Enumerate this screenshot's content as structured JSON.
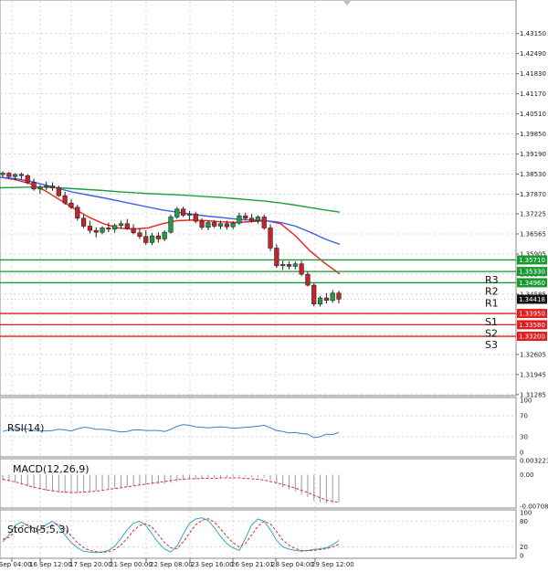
{
  "chart_data": [
    {
      "type": "candlestick",
      "ylim": [
        1.3128,
        1.4422
      ],
      "yticks": [
        "1.43150",
        "1.42490",
        "1.41830",
        "1.41170",
        "1.40510",
        "1.39850",
        "1.39190",
        "1.38530",
        "1.37870",
        "1.37225",
        "1.36565",
        "1.35905",
        "1.35245",
        "1.34585",
        "1.33925",
        "1.33265",
        "1.32605",
        "1.31945",
        "1.31285"
      ],
      "xticks": [
        "Sep 04:00",
        "16 Sep 12:00",
        "17 Sep 20:00",
        "21 Sep 00:00",
        "22 Sep 08:00",
        "23 Sep 16:00",
        "26 Sep 21:01",
        "28 Sep 04:00",
        "29 Sep 12:00"
      ],
      "candles": [
        [
          1.3851,
          1.3862,
          1.3843,
          1.3856
        ],
        [
          1.3856,
          1.386,
          1.3838,
          1.3845
        ],
        [
          1.3845,
          1.3856,
          1.3832,
          1.3852
        ],
        [
          1.3852,
          1.3858,
          1.3835,
          1.3848
        ],
        [
          1.3848,
          1.3852,
          1.382,
          1.3826
        ],
        [
          1.3826,
          1.3838,
          1.3798,
          1.3804
        ],
        [
          1.3804,
          1.3818,
          1.3788,
          1.381
        ],
        [
          1.381,
          1.3828,
          1.38,
          1.3814
        ],
        [
          1.3814,
          1.3826,
          1.3798,
          1.3808
        ],
        [
          1.3808,
          1.3815,
          1.3778,
          1.3782
        ],
        [
          1.3782,
          1.3795,
          1.3752,
          1.3758
        ],
        [
          1.3758,
          1.377,
          1.3738,
          1.3744
        ],
        [
          1.3744,
          1.3752,
          1.37,
          1.3708
        ],
        [
          1.3708,
          1.372,
          1.3675,
          1.3682
        ],
        [
          1.3682,
          1.37,
          1.3658,
          1.3668
        ],
        [
          1.3668,
          1.3678,
          1.3645,
          1.3662
        ],
        [
          1.3662,
          1.3682,
          1.3655,
          1.3676
        ],
        [
          1.3676,
          1.3694,
          1.3662,
          1.3672
        ],
        [
          1.3672,
          1.369,
          1.366,
          1.3684
        ],
        [
          1.3684,
          1.37,
          1.3676,
          1.369
        ],
        [
          1.369,
          1.3706,
          1.367,
          1.3675
        ],
        [
          1.3675,
          1.3688,
          1.3655,
          1.366
        ],
        [
          1.366,
          1.3676,
          1.364,
          1.3648
        ],
        [
          1.3648,
          1.3668,
          1.362,
          1.3628
        ],
        [
          1.3628,
          1.366,
          1.362,
          1.365
        ],
        [
          1.365,
          1.3662,
          1.3628,
          1.364
        ],
        [
          1.364,
          1.3668,
          1.3632,
          1.3662
        ],
        [
          1.3662,
          1.372,
          1.3658,
          1.3712
        ],
        [
          1.3712,
          1.3745,
          1.3706,
          1.3738
        ],
        [
          1.3738,
          1.3746,
          1.3712,
          1.3718
        ],
        [
          1.3718,
          1.3732,
          1.3702,
          1.3722
        ],
        [
          1.3722,
          1.373,
          1.3692,
          1.3698
        ],
        [
          1.3698,
          1.3708,
          1.367,
          1.3678
        ],
        [
          1.3678,
          1.37,
          1.3668,
          1.3694
        ],
        [
          1.3694,
          1.3702,
          1.3676,
          1.3682
        ],
        [
          1.3682,
          1.37,
          1.3672,
          1.369
        ],
        [
          1.369,
          1.37,
          1.367,
          1.368
        ],
        [
          1.368,
          1.3698,
          1.3672,
          1.3692
        ],
        [
          1.3692,
          1.3726,
          1.3686,
          1.3716
        ],
        [
          1.3716,
          1.3726,
          1.37,
          1.3708
        ],
        [
          1.3708,
          1.3722,
          1.3694,
          1.37
        ],
        [
          1.37,
          1.3718,
          1.369,
          1.3712
        ],
        [
          1.3712,
          1.372,
          1.367,
          1.3676
        ],
        [
          1.3676,
          1.3688,
          1.36,
          1.361
        ],
        [
          1.361,
          1.3622,
          1.3545,
          1.3552
        ],
        [
          1.3552,
          1.3568,
          1.3538,
          1.3556
        ],
        [
          1.3556,
          1.3566,
          1.354,
          1.355
        ],
        [
          1.355,
          1.3566,
          1.354,
          1.3558
        ],
        [
          1.3558,
          1.3568,
          1.3518,
          1.3524
        ],
        [
          1.3524,
          1.3532,
          1.3484,
          1.3488
        ],
        [
          1.3488,
          1.3494,
          1.3418,
          1.3426
        ],
        [
          1.3426,
          1.3452,
          1.3418,
          1.3446
        ],
        [
          1.3446,
          1.3462,
          1.3428,
          1.3438
        ],
        [
          1.3438,
          1.3472,
          1.343,
          1.3462
        ],
        [
          1.3462,
          1.347,
          1.3428,
          1.3442
        ]
      ],
      "moving_averages": [
        {
          "color": "#e8231a",
          "values": [
            1.3843,
            1.3835,
            1.3822,
            1.38,
            1.377,
            1.374,
            1.3712,
            1.369,
            1.3676,
            1.3672,
            1.3676,
            1.369,
            1.37,
            1.3702,
            1.37,
            1.3696,
            1.3694,
            1.3697,
            1.37,
            1.369,
            1.365,
            1.36,
            1.356,
            1.3525
          ]
        },
        {
          "color": "#3d5ee8",
          "values": [
            1.3843,
            1.3838,
            1.383,
            1.3818,
            1.3805,
            1.3793,
            1.3784,
            1.3775,
            1.3765,
            1.3755,
            1.3745,
            1.3735,
            1.3728,
            1.3721,
            1.3715,
            1.371,
            1.3705,
            1.3702,
            1.37,
            1.3694,
            1.3682,
            1.3662,
            1.364,
            1.3622
          ]
        },
        {
          "color": "#1e9e3f",
          "values": [
            1.3808,
            1.3809,
            1.381,
            1.381,
            1.3808,
            1.3805,
            1.3802,
            1.3799,
            1.3795,
            1.3792,
            1.3789,
            1.3787,
            1.3785,
            1.3782,
            1.3779,
            1.3776,
            1.3772,
            1.3768,
            1.3764,
            1.3758,
            1.3751,
            1.3743,
            1.3735,
            1.3728
          ]
        }
      ],
      "levels": [
        {
          "value": 1.3571,
          "label": "1.35710",
          "name": "",
          "color": "#1a9a2e"
        },
        {
          "value": 1.3533,
          "label": "1.35330",
          "name": "R3",
          "color": "#1a9a2e"
        },
        {
          "value": 1.3496,
          "label": "1.34960",
          "name": "R2",
          "color": "#1a9a2e"
        },
        {
          "value": 1.3395,
          "label": "1.33950",
          "name": "S1",
          "color": "#e21d1d"
        },
        {
          "value": 1.3358,
          "label": "1.33580",
          "name": "S2",
          "color": "#e21d1d"
        },
        {
          "value": 1.332,
          "label": "1.33200",
          "name": "S3",
          "color": "#e21d1d"
        }
      ],
      "r1_label": "R1",
      "current_price": {
        "value": 1.34418,
        "label": "1.34418"
      }
    },
    {
      "type": "line",
      "label": "RSI(14)",
      "ylim": [
        0,
        100
      ],
      "yticks": [
        "100",
        "70",
        "30",
        "0"
      ],
      "color": "#3a7ec8",
      "values": [
        40,
        43,
        44,
        44,
        45,
        42,
        41,
        41,
        42,
        44,
        43,
        41,
        45,
        48,
        47,
        44,
        44,
        43,
        41,
        39,
        40,
        43,
        43,
        42,
        42,
        42,
        40,
        44,
        50,
        53,
        52,
        49,
        48,
        47,
        48,
        49,
        48,
        46,
        47,
        48,
        49,
        50,
        52,
        47,
        42,
        40,
        37,
        38,
        36,
        35,
        28,
        30,
        35,
        34,
        38
      ]
    },
    {
      "type": "bar",
      "label": "MACD(12,26,9)",
      "ylim": [
        -0.007088,
        0.003223
      ],
      "yticks": [
        "0.003223",
        "0.00",
        "-0.007088"
      ],
      "bars": [
        -0.0012,
        -0.0015,
        -0.0018,
        -0.0022,
        -0.0026,
        -0.003,
        -0.0033,
        -0.0036,
        -0.0038,
        -0.004,
        -0.0041,
        -0.0042,
        -0.0041,
        -0.004,
        -0.0038,
        -0.0036,
        -0.0034,
        -0.0032,
        -0.003,
        -0.0028,
        -0.0026,
        -0.0025,
        -0.0024,
        -0.0023,
        -0.0022,
        -0.0021,
        -0.002,
        -0.0018,
        -0.0015,
        -0.0012,
        -0.001,
        -0.0009,
        -0.0008,
        -0.0008,
        -0.0007,
        -0.0006,
        -0.0006,
        -0.0005,
        -0.0004,
        -0.0004,
        -0.0005,
        -0.0005,
        -0.0006,
        -0.0012,
        -0.002,
        -0.0028,
        -0.0033,
        -0.0038,
        -0.0044,
        -0.005,
        -0.0058,
        -0.0062,
        -0.0064,
        -0.0063,
        -0.0062
      ],
      "signal": [
        -0.001,
        -0.0013,
        -0.0016,
        -0.002,
        -0.0024,
        -0.0028,
        -0.0031,
        -0.0034,
        -0.0036,
        -0.0038,
        -0.0039,
        -0.004,
        -0.004,
        -0.0039,
        -0.0038,
        -0.0037,
        -0.0035,
        -0.0033,
        -0.0031,
        -0.0029,
        -0.0027,
        -0.0025,
        -0.0023,
        -0.0021,
        -0.0019,
        -0.0017,
        -0.0015,
        -0.0013,
        -0.0011,
        -0.001,
        -0.0009,
        -0.0009,
        -0.0008,
        -0.0008,
        -0.0008,
        -0.0007,
        -0.0007,
        -0.0007,
        -0.0007,
        -0.0008,
        -0.0009,
        -0.001,
        -0.0012,
        -0.0015,
        -0.0018,
        -0.0022,
        -0.0026,
        -0.003,
        -0.0035,
        -0.004,
        -0.0046,
        -0.0052,
        -0.0057,
        -0.006,
        -0.0062
      ],
      "signal_color": "#e02b2b"
    },
    {
      "type": "line",
      "label": "Stoch(5,5,3)",
      "ylim": [
        0,
        100
      ],
      "yticks": [
        "100",
        "80",
        "20",
        "0"
      ],
      "main_color": "#2fa7c9",
      "signal_color": "#e02b2b",
      "main": [
        32,
        48,
        70,
        78,
        70,
        54,
        60,
        72,
        80,
        68,
        48,
        30,
        18,
        10,
        8,
        7,
        8,
        12,
        22,
        40,
        60,
        75,
        80,
        70,
        50,
        30,
        15,
        8,
        22,
        50,
        75,
        85,
        88,
        82,
        65,
        45,
        28,
        18,
        12,
        40,
        72,
        85,
        80,
        60,
        35,
        20,
        15,
        12,
        10,
        12,
        14,
        16,
        18,
        25,
        35
      ],
      "signal": [
        38,
        42,
        56,
        68,
        72,
        64,
        60,
        64,
        72,
        74,
        62,
        46,
        30,
        18,
        12,
        9,
        8,
        9,
        14,
        25,
        40,
        58,
        70,
        74,
        66,
        48,
        30,
        18,
        16,
        32,
        52,
        72,
        82,
        86,
        78,
        62,
        45,
        30,
        20,
        28,
        48,
        68,
        80,
        74,
        56,
        36,
        24,
        16,
        12,
        11,
        12,
        14,
        16,
        20,
        26
      ]
    }
  ]
}
